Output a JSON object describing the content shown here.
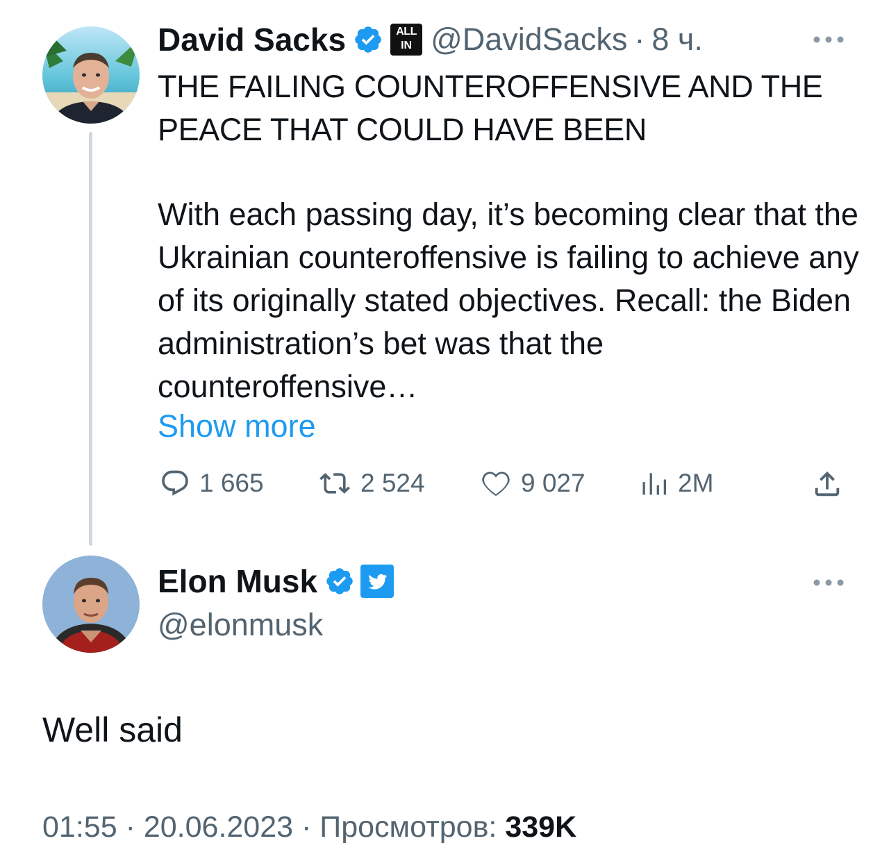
{
  "quoted_tweet": {
    "author_name": "David Sacks",
    "handle": "@DavidSacks",
    "separator": "·",
    "time_ago": "8 ч.",
    "affiliate_badge": "ALL IN",
    "headline": "THE FAILING COUNTEROFFENSIVE AND THE PEACE THAT COULD HAVE BEEN",
    "body": "With each passing day, it’s becoming clear that the Ukrainian counteroffensive is failing to achieve any of its originally stated objectives. Recall: the Biden administration’s bet was that the counteroffensive…",
    "show_more_label": "Show more",
    "more_icon": "more-horizontal-icon",
    "actions": {
      "replies": "1 665",
      "retweets": "2 524",
      "likes": "9 027",
      "views": "2M"
    }
  },
  "reply": {
    "author_name": "Elon Musk",
    "handle": "@elonmusk",
    "text": "Well said",
    "more_icon": "more-horizontal-icon"
  },
  "footer": {
    "time": "01:55",
    "date": "20.06.2023",
    "separator": "·",
    "views_label": "Просмотров:",
    "views_count": "339K"
  },
  "colors": {
    "text": "#0f1419",
    "secondary": "#536471",
    "link": "#1d9bf0",
    "verified": "#1d9bf0",
    "thread_line": "#cfd9de"
  }
}
